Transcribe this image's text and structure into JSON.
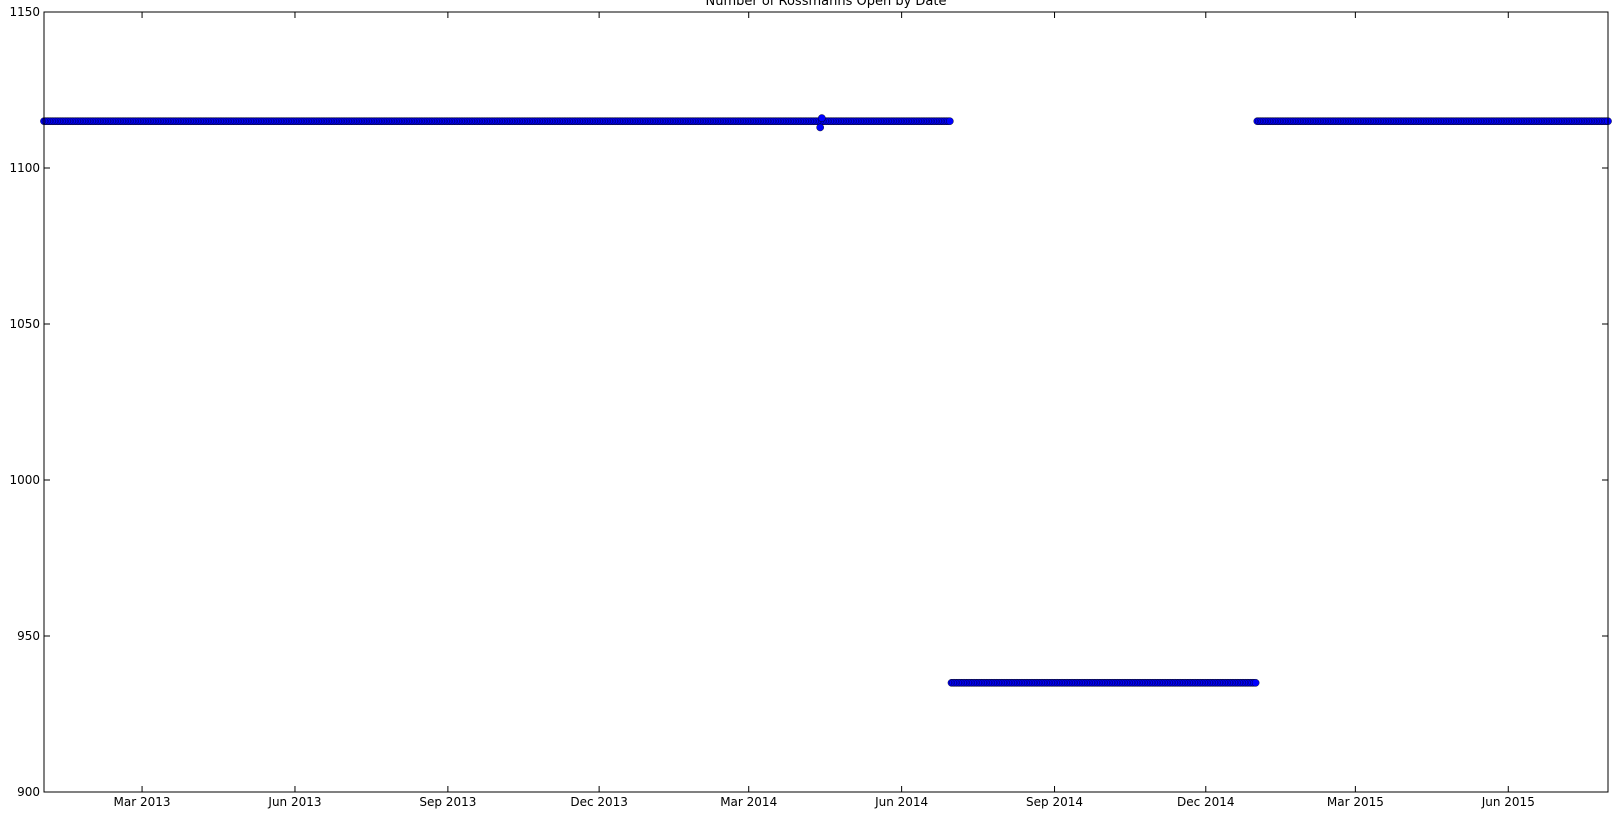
{
  "chart_data": {
    "type": "scatter",
    "title": "Number of Rossmanns Open by Date",
    "xlabel": "",
    "ylabel": "",
    "x_range": [
      "2013-01-01",
      "2015-07-31"
    ],
    "ylim": [
      900,
      1150
    ],
    "y_ticks": [
      900,
      950,
      1000,
      1050,
      1100,
      1150
    ],
    "x_ticks": [
      {
        "date": "2013-03-01",
        "label": "Mar 2013"
      },
      {
        "date": "2013-06-01",
        "label": "Jun 2013"
      },
      {
        "date": "2013-09-01",
        "label": "Sep 2013"
      },
      {
        "date": "2013-12-01",
        "label": "Dec 2013"
      },
      {
        "date": "2014-03-01",
        "label": "Mar 2014"
      },
      {
        "date": "2014-06-01",
        "label": "Jun 2014"
      },
      {
        "date": "2014-09-01",
        "label": "Sep 2014"
      },
      {
        "date": "2014-12-01",
        "label": "Dec 2014"
      },
      {
        "date": "2015-03-01",
        "label": "Mar 2015"
      },
      {
        "date": "2015-06-01",
        "label": "Jun 2015"
      }
    ],
    "grid": false,
    "series": [
      {
        "color": "#0000ff",
        "segments": [
          {
            "start": "2013-01-01",
            "end": "2014-06-30",
            "value": 1115
          },
          {
            "start": "2014-07-01",
            "end": "2014-12-31",
            "value": 935
          },
          {
            "start": "2015-01-01",
            "end": "2015-07-31",
            "value": 1115
          }
        ],
        "outliers": [
          {
            "date": "2014-04-13",
            "value": 1113
          },
          {
            "date": "2014-04-14",
            "value": 1116
          }
        ]
      }
    ]
  }
}
